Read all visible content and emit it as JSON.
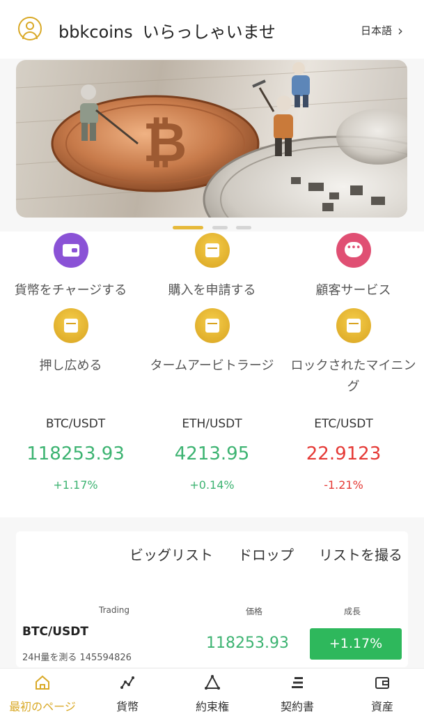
{
  "header": {
    "brand": "bbkcoins",
    "welcome": "いらっしゃいませ",
    "language": "日本語"
  },
  "banner": {
    "slides": 3,
    "active_slide": 1
  },
  "quick_actions": [
    {
      "label": "貨幣をチャージする",
      "icon": "wallet-icon",
      "color": "#8a52d6"
    },
    {
      "label": "購入を申請する",
      "icon": "box-icon",
      "color": "#e0ad2a"
    },
    {
      "label": "顧客サービス",
      "icon": "chat-icon",
      "color": "#e04f73"
    },
    {
      "label": "押し広める",
      "icon": "box-icon",
      "color": "#e0ad2a"
    },
    {
      "label": "タームアービトラージ",
      "icon": "box-icon",
      "color": "#e0ad2a"
    },
    {
      "label": "ロックされたマイニング",
      "icon": "box-icon",
      "color": "#e0ad2a"
    }
  ],
  "tickers": [
    {
      "symbol": "BTC/USDT",
      "price": "118253.93",
      "change": "+1.17%",
      "trend": "up"
    },
    {
      "symbol": "ETH/USDT",
      "price": "4213.95",
      "change": "+0.14%",
      "trend": "up"
    },
    {
      "symbol": "ETC/USDT",
      "price": "22.9123",
      "change": "-1.21%",
      "trend": "down"
    }
  ],
  "market": {
    "tabs": [
      "ビッグリスト",
      "ドロップ",
      "リストを撮る"
    ],
    "columns": {
      "pair": "Trading",
      "price": "価格",
      "growth": "成長"
    },
    "rows": [
      {
        "symbol": "BTC/USDT",
        "volume": "24H量を測る 145594826",
        "price": "118253.93",
        "change": "+1.17%"
      }
    ]
  },
  "tabbar": [
    {
      "label": "最初のページ",
      "icon": "home-icon",
      "active": true
    },
    {
      "label": "貨幣",
      "icon": "chart-icon",
      "active": false
    },
    {
      "label": "約束権",
      "icon": "triangle-icon",
      "active": false
    },
    {
      "label": "契約書",
      "icon": "list-icon",
      "active": false
    },
    {
      "label": "資産",
      "icon": "wallet-icon",
      "active": false
    }
  ],
  "colors": {
    "accent": "#d9a927",
    "up": "#3cb371",
    "down": "#e53935",
    "button_green": "#2eb85c"
  }
}
